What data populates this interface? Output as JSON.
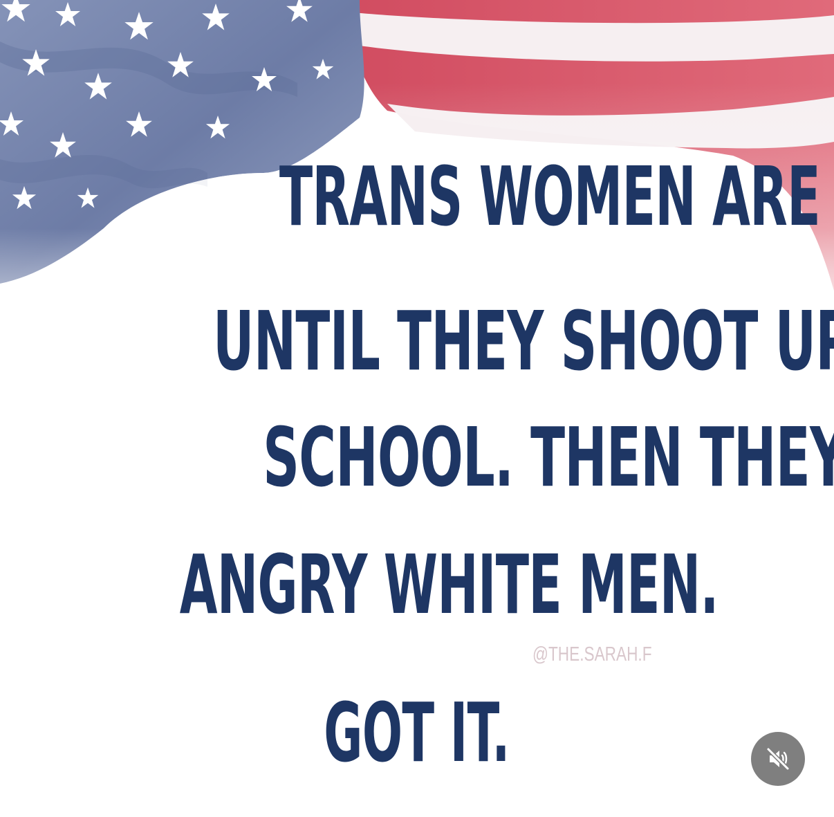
{
  "post": {
    "lines": [
      "TRANS WOMEN ARE “WOMEN”",
      "UNTIL THEY SHOOT UP A",
      "SCHOOL. THEN THEY ARE JUST",
      "ANGRY WHITE MEN.",
      "GOT IT."
    ],
    "watermark": "@THE.SARAH.F"
  },
  "controls": {
    "mute_icon": "speaker-muted-icon"
  },
  "colors": {
    "text": "#1e3664",
    "flag_blue": "#6f7fa8",
    "flag_red": "#d95a6c",
    "watermark": "#d9c7cc",
    "button_bg": "#7f7f7f"
  }
}
